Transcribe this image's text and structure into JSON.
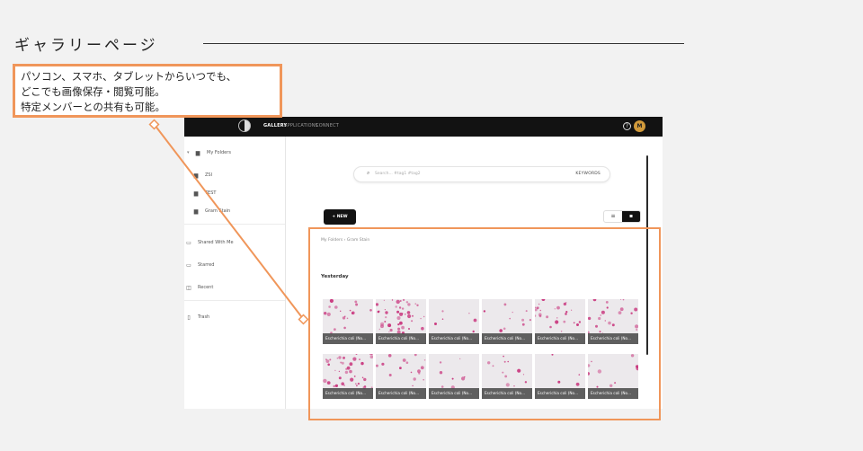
{
  "page": {
    "title": "ギャラリーページ"
  },
  "callout": {
    "lines": [
      "パソコン、スマホ、タブレットからいつでも、",
      "どこでも画像保存・閲覧可能。",
      "特定メンバーとの共有も可能。"
    ]
  },
  "app": {
    "nav": {
      "gallery": "GALLERY",
      "applications": "APPLICATIONS",
      "connect": "CONNECT"
    },
    "user_initial": "M",
    "sidebar": {
      "my_folders": "My Folders",
      "items": [
        {
          "label": "ZSI"
        },
        {
          "label": "TEST"
        },
        {
          "label": "Gram Stain"
        }
      ],
      "shared_with_me": "Shared With Me",
      "starred": "Starred",
      "recent": "Recent",
      "trash": "Trash"
    },
    "search": {
      "placeholder": "Search...  #tag1 #tag2",
      "keywords_label": "KEYWORDS"
    },
    "new_label": "+ NEW",
    "breadcrumb": "My Folders  ›  Gram Stain",
    "section": "Yesterday",
    "thumbnails": [
      {
        "caption": "Escherichia coli (No..."
      },
      {
        "caption": "Escherichia coli (No..."
      },
      {
        "caption": "Escherichia coli (No..."
      },
      {
        "caption": "Escherichia coli (No..."
      },
      {
        "caption": "Escherichia coli (No..."
      },
      {
        "caption": "Escherichia coli (No..."
      },
      {
        "caption": "Escherichia coli (No..."
      },
      {
        "caption": "Escherichia coli (No..."
      },
      {
        "caption": "Escherichia coli (No..."
      },
      {
        "caption": "Escherichia coli (No..."
      },
      {
        "caption": "Escherichia coli (No..."
      },
      {
        "caption": "Escherichia coli (No..."
      }
    ]
  },
  "colors": {
    "accent": "#f0965a",
    "topbar": "#121212",
    "stain": "#c8307a",
    "avatar": "#d19a3b"
  }
}
